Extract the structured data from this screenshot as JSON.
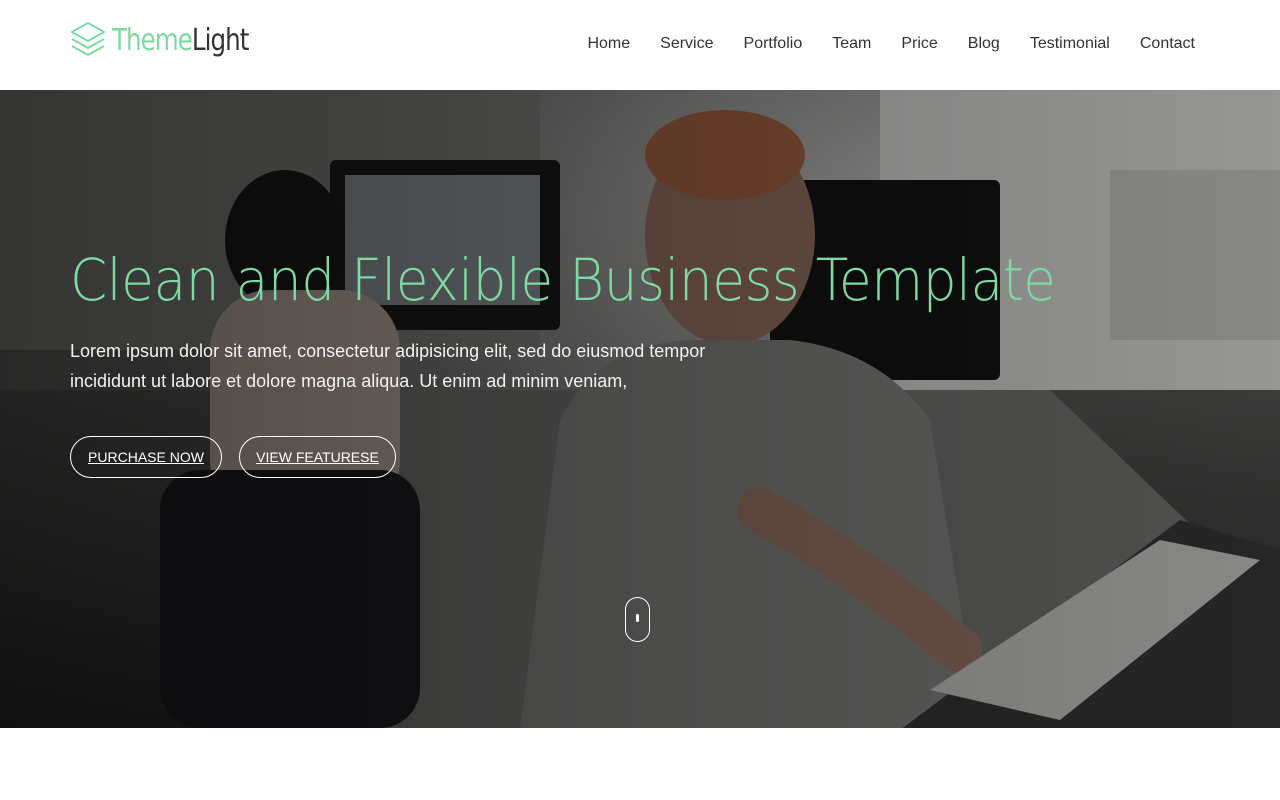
{
  "brand": {
    "logo_part1": "Theme",
    "logo_part2": "Light",
    "accent_color": "#7fd9a3",
    "logo_icon": "stacked-layers-icon"
  },
  "nav": {
    "items": [
      {
        "label": "Home"
      },
      {
        "label": "Service"
      },
      {
        "label": "Portfolio"
      },
      {
        "label": "Team"
      },
      {
        "label": "Price"
      },
      {
        "label": "Blog"
      },
      {
        "label": "Testimonial"
      },
      {
        "label": "Contact"
      }
    ]
  },
  "hero": {
    "title": "Clean and Flexible Business Template",
    "description": "Lorem ipsum dolor sit amet, consectetur adipisicing elit, sed do eiusmod tempor incididunt ut labore et dolore magna aliqua. Ut enim ad minim veniam,",
    "primary_button": "PURCHASE NOW",
    "secondary_button": "VIEW FEATURESE",
    "scroll_icon": "mouse-scroll-icon"
  }
}
